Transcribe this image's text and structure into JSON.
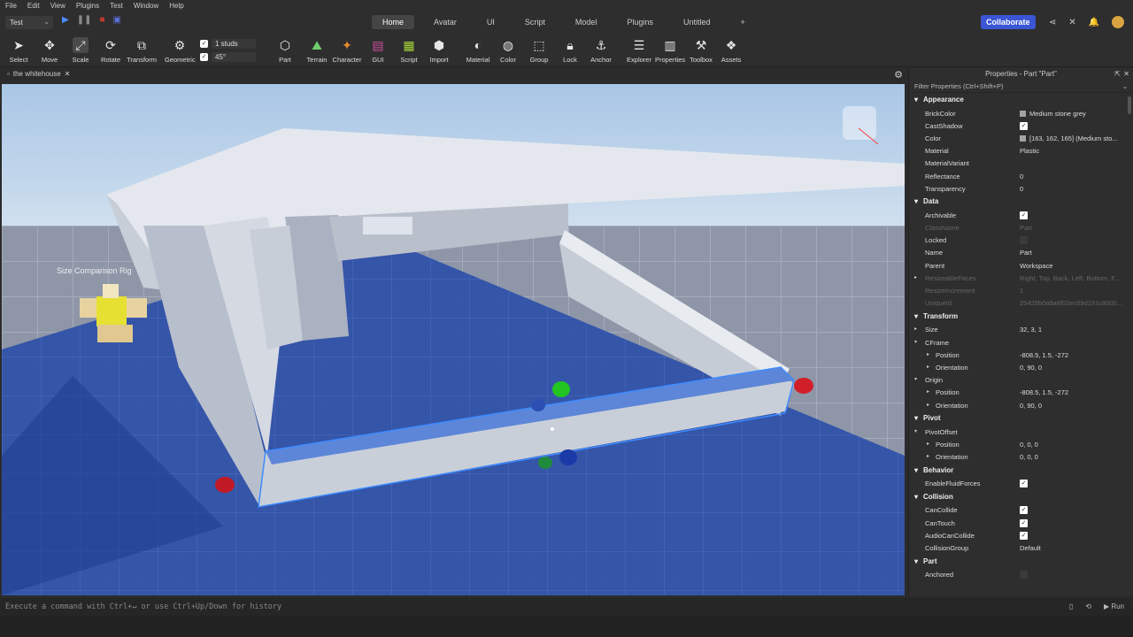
{
  "menu": [
    "File",
    "Edit",
    "View",
    "Plugins",
    "Test",
    "Window",
    "Help"
  ],
  "place_selector": "Test",
  "tabs": [
    "Home",
    "Avatar",
    "UI",
    "Script",
    "Model",
    "Plugins",
    "Untitled",
    "+"
  ],
  "collaborate": "Collaborate",
  "ribbon": {
    "tools": [
      "Select",
      "Move",
      "Scale",
      "Rotate",
      "Transform",
      "Geometric",
      "Part",
      "Terrain",
      "Character",
      "GUI",
      "Script",
      "Import",
      "Material",
      "Color",
      "Group",
      "Lock",
      "Anchor",
      "Explorer",
      "Properties",
      "Toolbox",
      "Assets"
    ],
    "snap_move": "1 studs",
    "snap_rotate": "45°"
  },
  "doc_tab": "the whitehouse",
  "viewport": {
    "label": "Size Comparison Rig"
  },
  "properties": {
    "title": "Properties - Part \"Part\"",
    "filter": "Filter Properties (Ctrl+Shift+P)",
    "appearance": {
      "header": "Appearance",
      "brickcolor_k": "BrickColor",
      "brickcolor_v": "Medium stone grey",
      "castshadow_k": "CastShadow",
      "color_k": "Color",
      "color_v": "[163, 162, 165] (Medium sto...",
      "material_k": "Material",
      "material_v": "Plastic",
      "materialvariant_k": "MaterialVariant",
      "reflectance_k": "Reflectance",
      "reflectance_v": "0",
      "transparency_k": "Transparency",
      "transparency_v": "0"
    },
    "data": {
      "header": "Data",
      "archivable_k": "Archivable",
      "classname_k": "ClassName",
      "classname_v": "Part",
      "locked_k": "Locked",
      "name_k": "Name",
      "name_v": "Part",
      "parent_k": "Parent",
      "parent_v": "Workspace",
      "resizeablefaces_k": "ResizeableFaces",
      "resizeablefaces_v": "Right, Top, Back, Left, Bottom, F...",
      "resizeincrement_k": "ResizeIncrement",
      "resizeincrement_v": "1",
      "uniqueid_k": "UniqueId",
      "uniqueid_v": "25425b0a9a6f02ec09d191c8000..."
    },
    "transform": {
      "header": "Transform",
      "size_k": "Size",
      "size_v": "32, 3, 1",
      "cframe_k": "CFrame",
      "cf_pos_k": "Position",
      "cf_pos_v": "-808.5, 1.5, -272",
      "cf_ori_k": "Orientation",
      "cf_ori_v": "0, 90, 0",
      "origin_k": "Origin",
      "or_pos_k": "Position",
      "or_pos_v": "-808.5, 1.5, -272",
      "or_ori_k": "Orientation",
      "or_ori_v": "0, 90, 0"
    },
    "pivot": {
      "header": "Pivot",
      "offset_k": "PivotOffset",
      "pos_k": "Position",
      "pos_v": "0, 0, 0",
      "ori_k": "Orientation",
      "ori_v": "0, 0, 0"
    },
    "behavior": {
      "header": "Behavior",
      "fluid_k": "EnableFluidForces"
    },
    "collision": {
      "header": "Collision",
      "cancollide_k": "CanCollide",
      "cantouch_k": "CanTouch",
      "audio_k": "AudioCanCollide",
      "group_k": "CollisionGroup",
      "group_v": "Default"
    },
    "part": {
      "header": "Part",
      "anchored_k": "Anchored"
    }
  },
  "command_bar": {
    "placeholder": "Execute a command with Ctrl+↵ or use Ctrl+Up/Down for history",
    "run": "Run"
  },
  "colors": {
    "accent": "#3a56d4",
    "selection": "#3d8bff",
    "baseplate": "#3a5fbd"
  }
}
